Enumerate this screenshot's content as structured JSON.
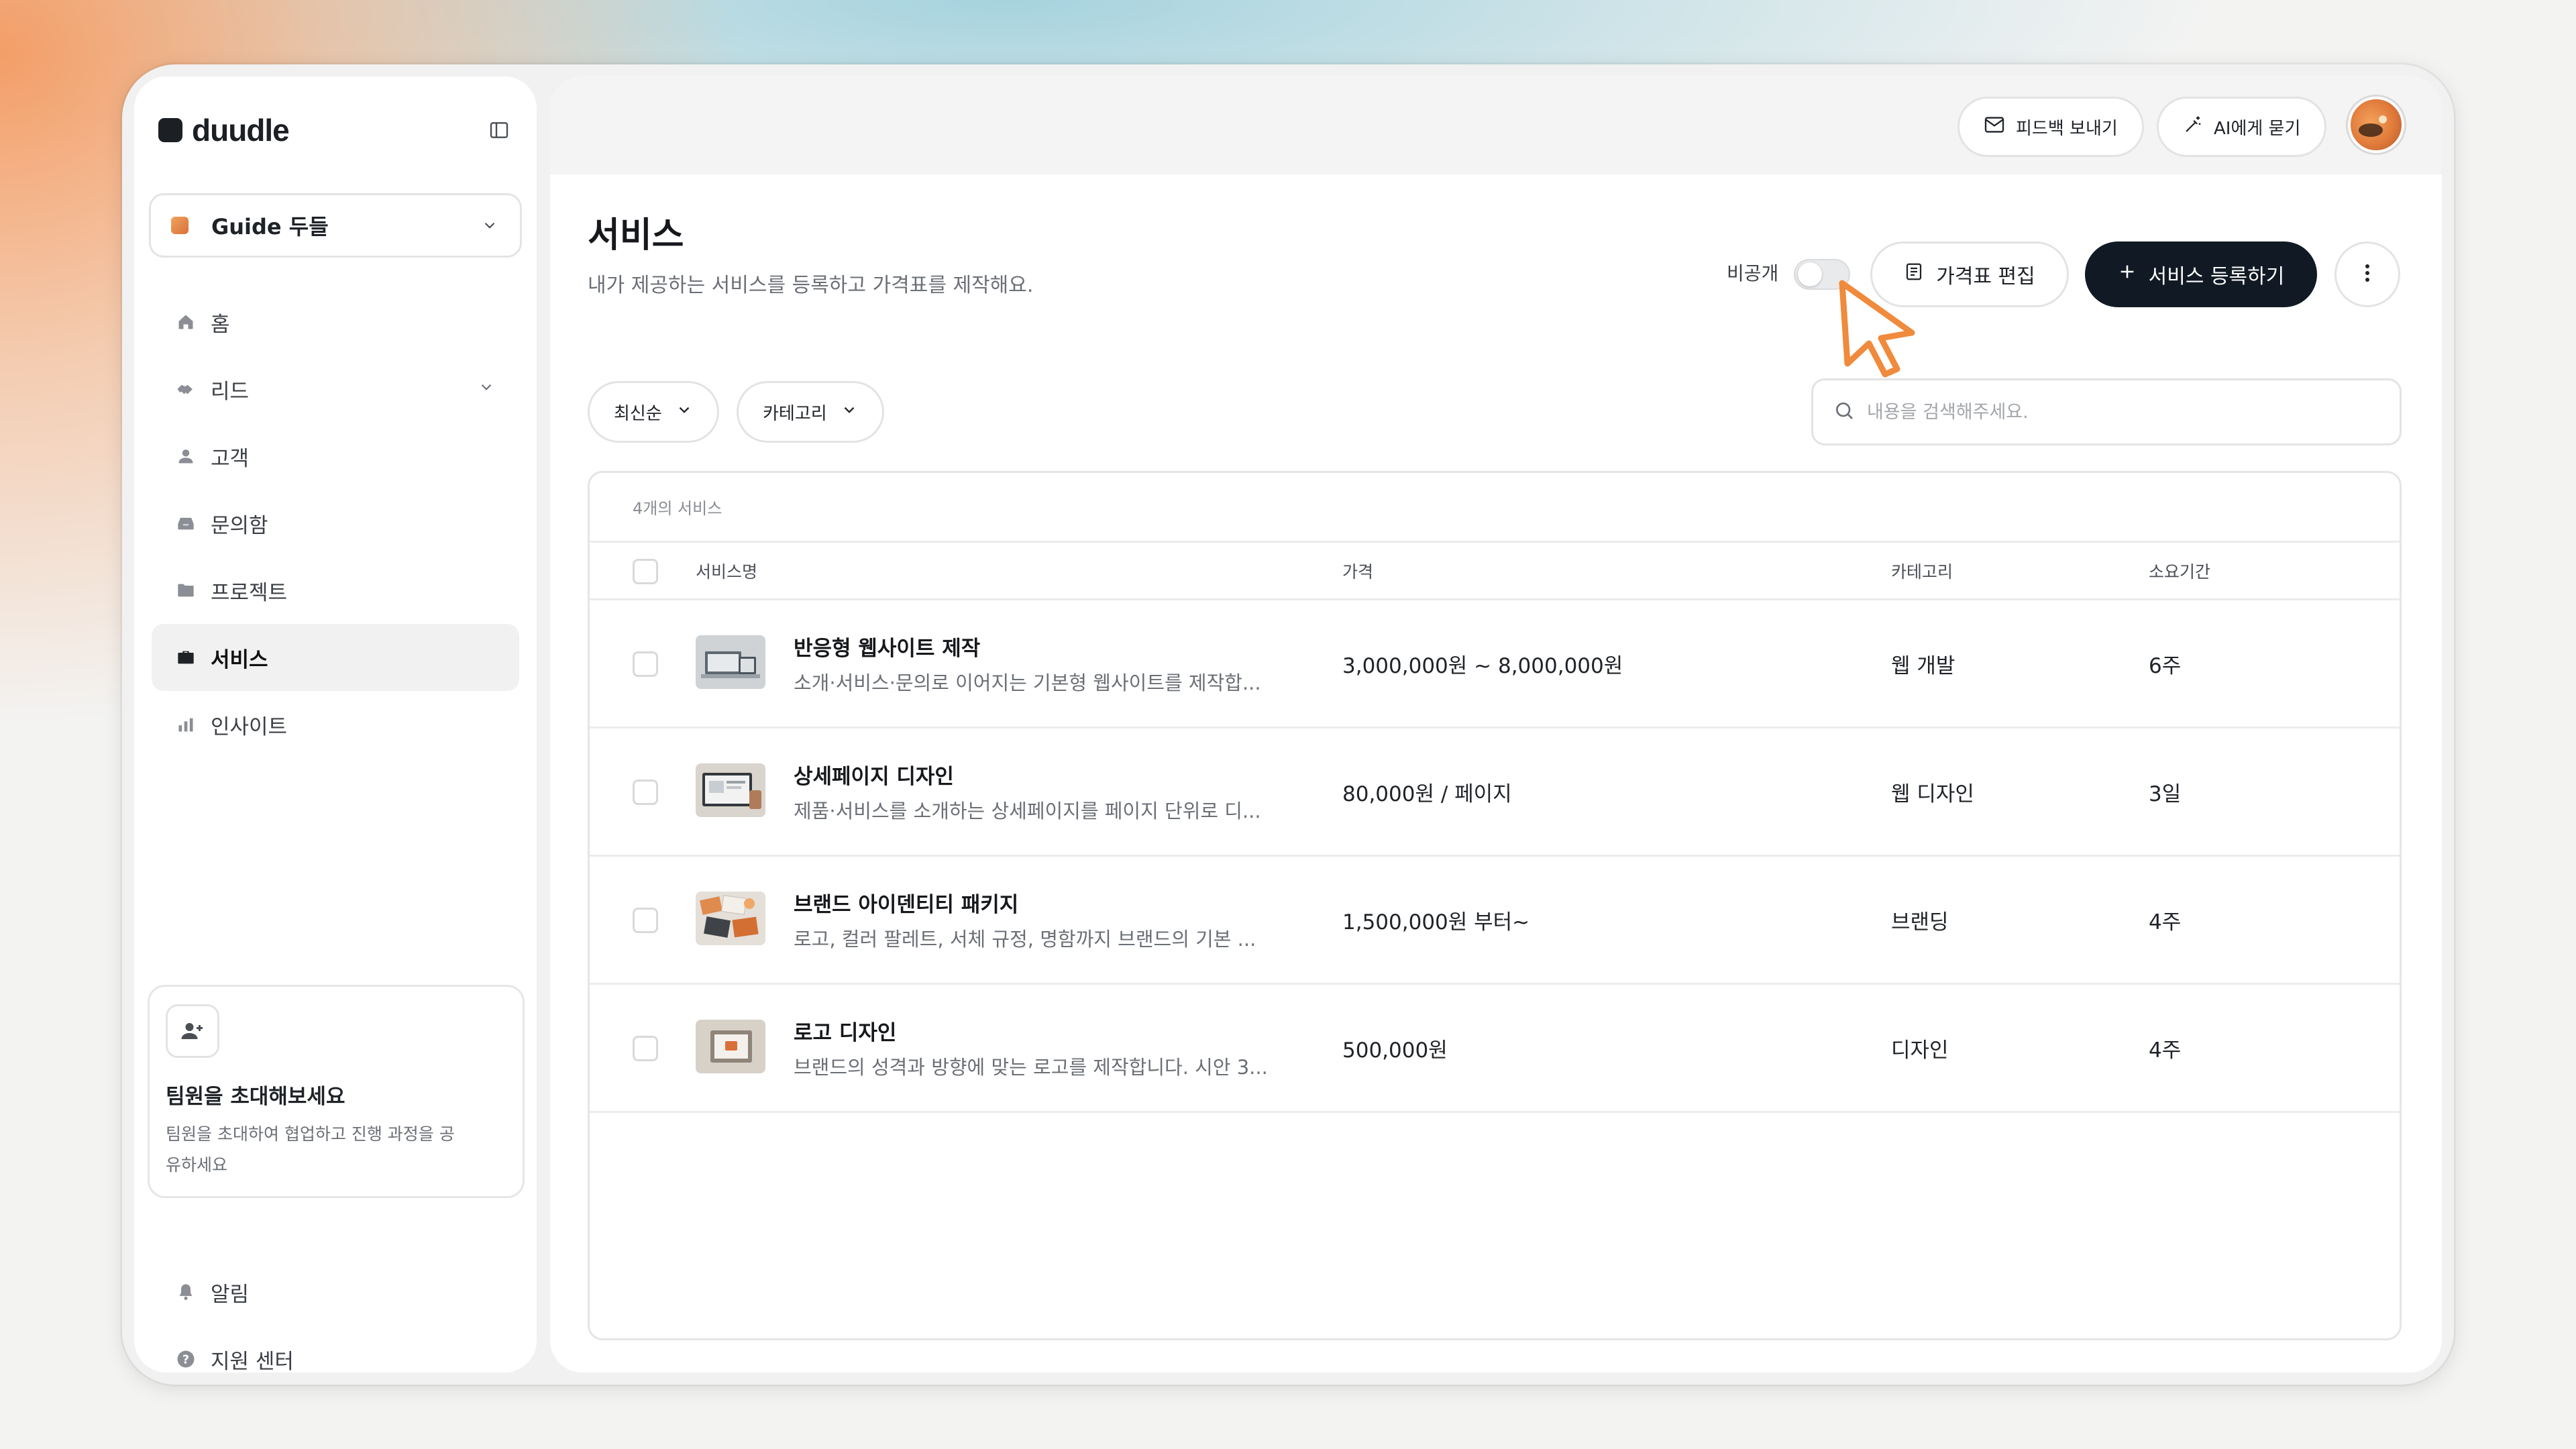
{
  "brand": {
    "name": "duudle"
  },
  "workspace": {
    "name": "Guide 두들"
  },
  "sidebar": {
    "items": [
      {
        "label": "홈",
        "icon": "home-icon"
      },
      {
        "label": "리드",
        "icon": "handshake-icon",
        "expandable": true
      },
      {
        "label": "고객",
        "icon": "user-icon"
      },
      {
        "label": "문의함",
        "icon": "inbox-icon"
      },
      {
        "label": "프로젝트",
        "icon": "folder-icon"
      },
      {
        "label": "서비스",
        "icon": "briefcase-icon",
        "active": true
      },
      {
        "label": "인사이트",
        "icon": "bar-chart-icon"
      }
    ],
    "invite": {
      "title": "팀원을 초대해보세요",
      "desc": "팀원을 초대하여 협업하고 진행 과정을 공유하세요"
    },
    "bottom": [
      {
        "label": "알림",
        "icon": "bell-icon"
      },
      {
        "label": "지원 센터",
        "icon": "help-icon"
      }
    ]
  },
  "topbar": {
    "feedback_label": "피드백 보내기",
    "ask_ai_label": "AI에게 묻기"
  },
  "page": {
    "title": "서비스",
    "subtitle": "내가 제공하는 서비스를 등록하고 가격표를 제작해요.",
    "private_label": "비공개",
    "private_on": false,
    "edit_price_label": "가격표 편집",
    "add_service_label": "서비스 등록하기"
  },
  "filters": {
    "sort_label": "최신순",
    "category_label": "카테고리",
    "search_placeholder": "내용을 검색해주세요."
  },
  "table": {
    "count_text": "4개의 서비스",
    "headers": {
      "name": "서비스명",
      "price": "가격",
      "category": "카테고리",
      "duration": "소요기간"
    },
    "rows": [
      {
        "name": "반응형 웹사이트 제작",
        "desc": "소개·서비스·문의로 이어지는 기본형 웹사이트를 제작합...",
        "price": "3,000,000원 ~ 8,000,000원",
        "category": "웹 개발",
        "duration": "6주"
      },
      {
        "name": "상세페이지 디자인",
        "desc": "제품·서비스를 소개하는 상세페이지를 페이지 단위로 디...",
        "price": "80,000원 / 페이지",
        "category": "웹 디자인",
        "duration": "3일"
      },
      {
        "name": "브랜드 아이덴티티 패키지",
        "desc": "로고, 컬러 팔레트, 서체 규정, 명함까지 브랜드의 기본 ...",
        "price": "1,500,000원 부터~",
        "category": "브랜딩",
        "duration": "4주"
      },
      {
        "name": "로고 디자인",
        "desc": "브랜드의 성격과 방향에 맞는 로고를 제작합니다. 시안 3...",
        "price": "500,000원",
        "category": "디자인",
        "duration": "4주"
      }
    ]
  },
  "colors": {
    "accent_dark": "#111a24",
    "cursor_orange": "#f08a3c"
  }
}
